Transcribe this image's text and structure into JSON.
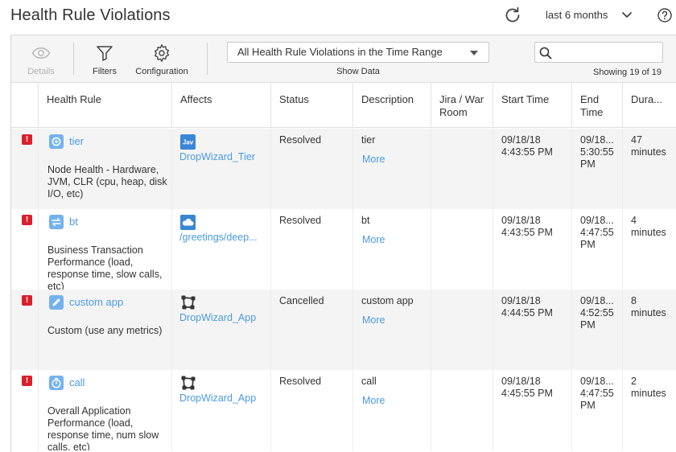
{
  "header": {
    "title": "Health Rule Violations",
    "time_range": "last 6 months"
  },
  "toolbar": {
    "details_label": "Details",
    "filters_label": "Filters",
    "configuration_label": "Configuration",
    "filter_value": "All Health Rule Violations in the Time Range",
    "show_data_label": "Show Data",
    "search_placeholder": "",
    "showing_text": "Showing 19 of 19"
  },
  "columns": {
    "health_rule": "Health Rule",
    "affects": "Affects",
    "status": "Status",
    "description": "Description",
    "jira": "Jira / War Room",
    "start_time": "Start Time",
    "end_time": "End Time",
    "duration": "Dura..."
  },
  "rows": [
    {
      "rule_icon": "tier-icon",
      "rule_name": "tier",
      "rule_desc": "Node Health - Hardware, JVM, CLR (cpu, heap, disk I/O, etc)",
      "affects_icon": "java-icon",
      "affects_icon_text": "Jav",
      "affects": "DropWizard_Tier",
      "status": "Resolved",
      "description": "tier",
      "more": "More",
      "start_date": "09/18/18",
      "start_time": "4:43:55 PM",
      "end_date": "09/18...",
      "end_time": "5:30:55 PM",
      "duration": "47 minutes"
    },
    {
      "rule_icon": "transaction-icon",
      "rule_name": "bt",
      "rule_desc": "Business Transaction Performance (load, response time, slow calls, etc)",
      "affects_icon": "cloud-icon",
      "affects": "/greetings/deep...",
      "status": "Resolved",
      "description": "bt",
      "more": "More",
      "start_date": "09/18/18",
      "start_time": "4:43:55 PM",
      "end_date": "09/18...",
      "end_time": "4:47:55 PM",
      "duration": "4 minutes"
    },
    {
      "rule_icon": "pencil-icon",
      "rule_name": "custom app",
      "rule_desc": "Custom (use any metrics)",
      "affects_icon": "app-nodes-icon",
      "affects": "DropWizard_App",
      "status": "Cancelled",
      "description": "custom app",
      "more": "More",
      "start_date": "09/18/18",
      "start_time": "4:44:55 PM",
      "end_date": "09/18...",
      "end_time": "4:52:55 PM",
      "duration": "8 minutes"
    },
    {
      "rule_icon": "stopwatch-icon",
      "rule_name": "call",
      "rule_desc": "Overall Application Performance (load, response time, num slow calls, etc)",
      "affects_icon": "app-nodes-icon",
      "affects": "DropWizard_App",
      "status": "Resolved",
      "description": "call",
      "more": "More",
      "start_date": "09/18/18",
      "start_time": "4:45:55 PM",
      "end_date": "09/18...",
      "end_time": "4:47:55 PM",
      "duration": "2 minutes"
    }
  ],
  "colors": {
    "link": "#4a9ae0",
    "error": "#d9202b",
    "rule_icon_bg": "#74b2ef",
    "affects_icon_bg": "#3a86d6"
  }
}
